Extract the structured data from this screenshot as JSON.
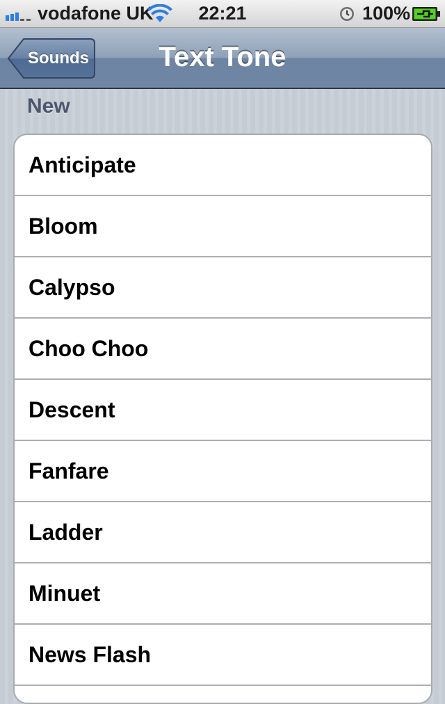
{
  "status_bar": {
    "carrier": "vodafone UK",
    "time": "22:21",
    "battery_percent": "100%"
  },
  "nav_bar": {
    "back_label": "Sounds",
    "title": "Text Tone"
  },
  "section": {
    "header": "New"
  },
  "tones": [
    {
      "label": "Anticipate"
    },
    {
      "label": "Bloom"
    },
    {
      "label": "Calypso"
    },
    {
      "label": "Choo Choo"
    },
    {
      "label": "Descent"
    },
    {
      "label": "Fanfare"
    },
    {
      "label": "Ladder"
    },
    {
      "label": "Minuet"
    },
    {
      "label": "News Flash"
    }
  ],
  "icons": {
    "signal": "signal-strength-icon",
    "wifi": "wifi-icon",
    "alarm": "alarm-clock-icon",
    "battery": "battery-charging-icon"
  },
  "colors": {
    "nav_bar": "#6f87a5",
    "background": "#c5ccd4",
    "section_header": "#4c566c",
    "wifi": "#2f7de1",
    "battery_fill": "#52d321"
  }
}
